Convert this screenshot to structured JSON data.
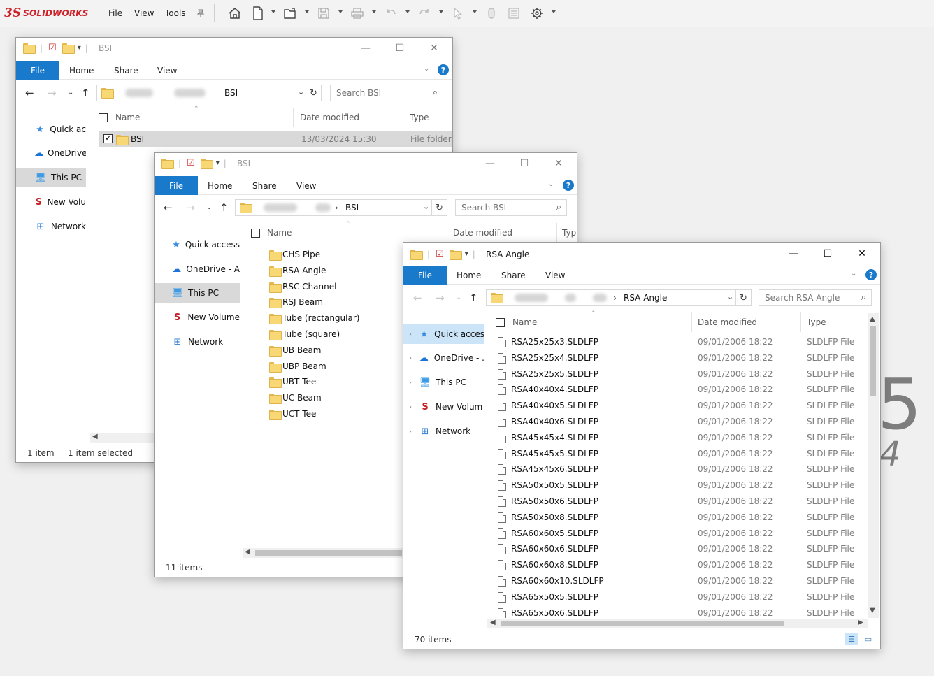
{
  "solidworks": {
    "logo_mark": "3S",
    "logo_text": "SOLIDWORKS",
    "menu": [
      "File",
      "View",
      "Tools"
    ],
    "pin_icon": "pin-icon",
    "splash_digit": "5",
    "splash_sub": "4"
  },
  "win1": {
    "title": "BSI",
    "tabs": {
      "file": "File",
      "home": "Home",
      "share": "Share",
      "view": "View"
    },
    "address_crumb": "BSI",
    "search_placeholder": "Search BSI",
    "columns": {
      "name": "Name",
      "date": "Date modified",
      "type": "Type"
    },
    "nav": [
      "Quick ac",
      "OneDrive",
      "This PC",
      "New Volu",
      "Network"
    ],
    "rows": [
      {
        "name": "BSI",
        "date": "13/03/2024 15:30",
        "type": "File folder"
      }
    ],
    "status_count": "1 item",
    "status_selected": "1 item selected"
  },
  "win2": {
    "title": "BSI",
    "tabs": {
      "file": "File",
      "home": "Home",
      "share": "Share",
      "view": "View"
    },
    "address_crumb": "BSI",
    "search_placeholder": "Search BSI",
    "columns": {
      "name": "Name",
      "date": "Date modified",
      "type": "Typ"
    },
    "nav": [
      "Quick access",
      "OneDrive - A",
      "This PC",
      "New Volume",
      "Network"
    ],
    "folders": [
      "CHS Pipe",
      "RSA Angle",
      "RSC Channel",
      "RSJ Beam",
      "Tube (rectangular)",
      "Tube (square)",
      "UB Beam",
      "UBP Beam",
      "UBT Tee",
      "UC Beam",
      "UCT Tee"
    ],
    "status_count": "11 items"
  },
  "win3": {
    "title": "RSA Angle",
    "tabs": {
      "file": "File",
      "home": "Home",
      "share": "Share",
      "view": "View"
    },
    "address_crumb": "RSA Angle",
    "search_placeholder": "Search RSA Angle",
    "columns": {
      "name": "Name",
      "date": "Date modified",
      "type": "Type"
    },
    "nav": [
      "Quick acces",
      "OneDrive - .",
      "This PC",
      "New Volum",
      "Network"
    ],
    "files": [
      {
        "name": "RSA25x25x3.SLDLFP",
        "date": "09/01/2006 18:22",
        "type": "SLDLFP File"
      },
      {
        "name": "RSA25x25x4.SLDLFP",
        "date": "09/01/2006 18:22",
        "type": "SLDLFP File"
      },
      {
        "name": "RSA25x25x5.SLDLFP",
        "date": "09/01/2006 18:22",
        "type": "SLDLFP File"
      },
      {
        "name": "RSA40x40x4.SLDLFP",
        "date": "09/01/2006 18:22",
        "type": "SLDLFP File"
      },
      {
        "name": "RSA40x40x5.SLDLFP",
        "date": "09/01/2006 18:22",
        "type": "SLDLFP File"
      },
      {
        "name": "RSA40x40x6.SLDLFP",
        "date": "09/01/2006 18:22",
        "type": "SLDLFP File"
      },
      {
        "name": "RSA45x45x4.SLDLFP",
        "date": "09/01/2006 18:22",
        "type": "SLDLFP File"
      },
      {
        "name": "RSA45x45x5.SLDLFP",
        "date": "09/01/2006 18:22",
        "type": "SLDLFP File"
      },
      {
        "name": "RSA45x45x6.SLDLFP",
        "date": "09/01/2006 18:22",
        "type": "SLDLFP File"
      },
      {
        "name": "RSA50x50x5.SLDLFP",
        "date": "09/01/2006 18:22",
        "type": "SLDLFP File"
      },
      {
        "name": "RSA50x50x6.SLDLFP",
        "date": "09/01/2006 18:22",
        "type": "SLDLFP File"
      },
      {
        "name": "RSA50x50x8.SLDLFP",
        "date": "09/01/2006 18:22",
        "type": "SLDLFP File"
      },
      {
        "name": "RSA60x60x5.SLDLFP",
        "date": "09/01/2006 18:22",
        "type": "SLDLFP File"
      },
      {
        "name": "RSA60x60x6.SLDLFP",
        "date": "09/01/2006 18:22",
        "type": "SLDLFP File"
      },
      {
        "name": "RSA60x60x8.SLDLFP",
        "date": "09/01/2006 18:22",
        "type": "SLDLFP File"
      },
      {
        "name": "RSA60x60x10.SLDLFP",
        "date": "09/01/2006 18:22",
        "type": "SLDLFP File"
      },
      {
        "name": "RSA65x50x5.SLDLFP",
        "date": "09/01/2006 18:22",
        "type": "SLDLFP File"
      },
      {
        "name": "RSA65x50x6.SLDLFP",
        "date": "09/01/2006 18:22",
        "type": "SLDLFP File"
      }
    ],
    "status_count": "70 items"
  },
  "colors": {
    "accent": "#1979ca",
    "selection": "#cce4f7",
    "sw_red": "#cc2229"
  }
}
